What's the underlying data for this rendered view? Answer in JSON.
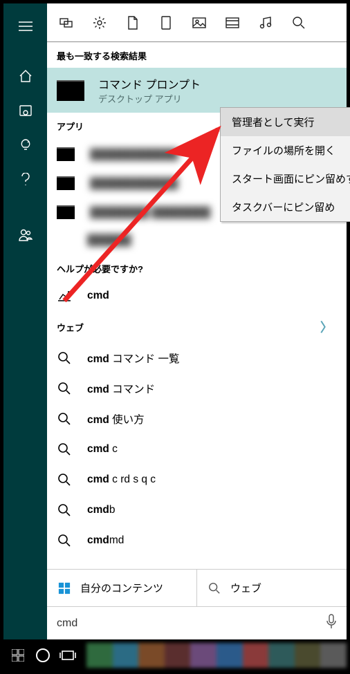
{
  "sections": {
    "best_match_header": "最も一致する検索結果",
    "apps_header": "アプリ",
    "help_header": "ヘルプが必要ですか?",
    "web_header": "ウェブ"
  },
  "best_match": {
    "title": "コマンド プロンプト",
    "subtitle": "デスクトップ アプリ"
  },
  "context_menu": {
    "items": [
      "管理者として実行",
      "ファイルの場所を開く",
      "スタート画面にピン留めする",
      "タスクバーにピン留め"
    ]
  },
  "apps_blur": [
    "████████████",
    "████████████",
    "████████ ████████",
    "██████"
  ],
  "help": {
    "item": "cmd"
  },
  "web_items": [
    {
      "bold": "cmd",
      "rest": " コマンド 一覧"
    },
    {
      "bold": "cmd",
      "rest": " コマンド"
    },
    {
      "bold": "cmd",
      "rest": " 使い方"
    },
    {
      "bold": "cmd",
      "rest": " c"
    },
    {
      "bold": "cmd",
      "rest": " c rd s q c"
    },
    {
      "bold": "cmd",
      "rest": "b"
    },
    {
      "bold": "cmd",
      "rest": "md"
    }
  ],
  "bottom_tabs": {
    "my_content": "自分のコンテンツ",
    "web": "ウェブ"
  },
  "search_input": {
    "value": "cmd"
  },
  "taskbar_colors": [
    "#2f6a3e",
    "#2b6b84",
    "#7a4a28",
    "#5a2e2e",
    "#6b4a7a",
    "#2b5a8a",
    "#8a3a3a",
    "#2e5a5a",
    "#4a4a2e",
    "#5a5a5a"
  ]
}
